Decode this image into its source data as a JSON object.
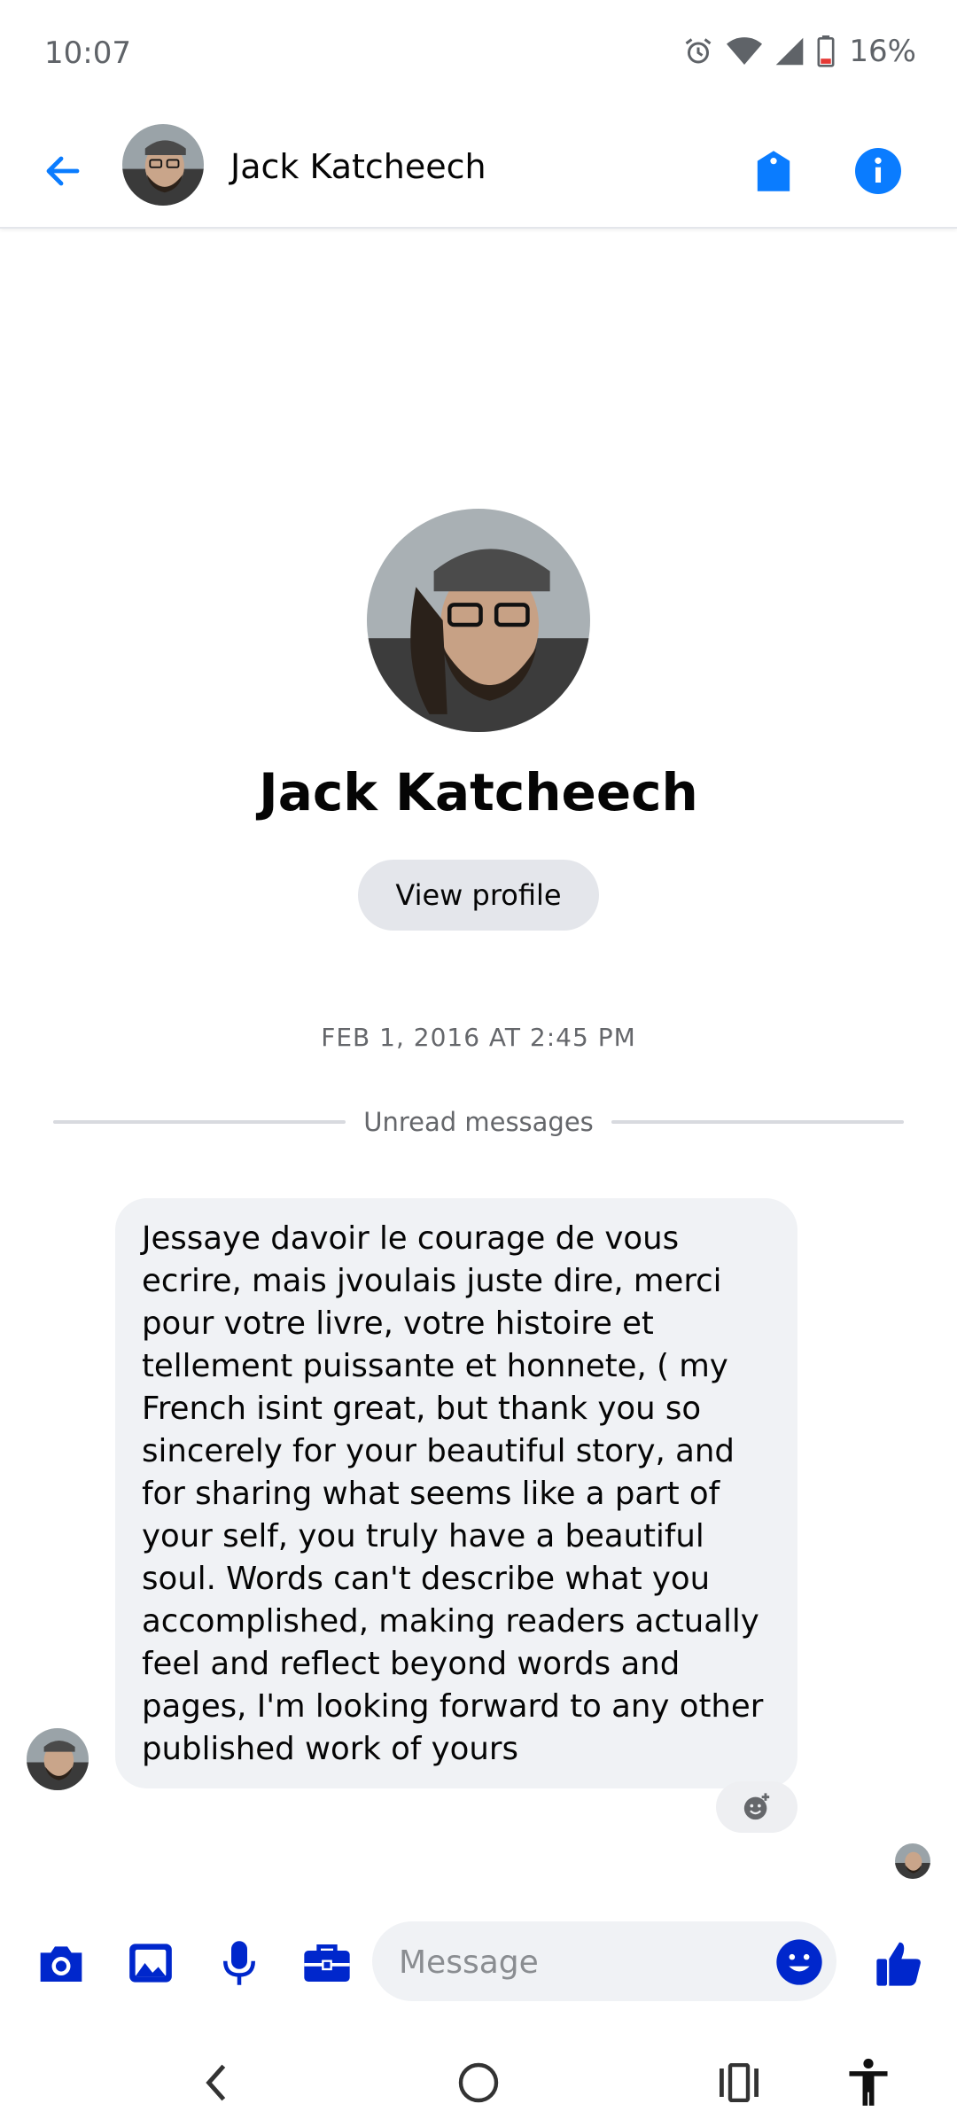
{
  "status_bar": {
    "time": "10:07",
    "battery": "16%",
    "icons": [
      "alarm-icon",
      "wifi-icon",
      "signal-icon",
      "battery-low-icon"
    ]
  },
  "header": {
    "back_icon": "arrow-left-icon",
    "contact_name": "Jack Katcheech",
    "tag_icon": "tag-icon",
    "info_icon": "info-icon"
  },
  "profile": {
    "name": "Jack Katcheech",
    "view_profile_label": "View profile"
  },
  "conversation": {
    "timestamp": "FEB 1, 2016 AT 2:45 PM",
    "unread_label": "Unread messages",
    "messages": [
      {
        "sender": "Jack Katcheech",
        "text": "Jessaye davoir le courage de vous ecrire, mais jvoulais juste dire, merci pour votre livre, votre histoire et tellement puissante et honnete, ( my French isint great, but thank you so sincerely for your beautiful story, and for sharing what seems like a part of your self, you truly have a beautiful soul. Words can't describe what you accomplished, making readers actually feel and reflect beyond words and pages, I'm looking forward to any other published work of yours"
      }
    ]
  },
  "composer": {
    "placeholder": "Message",
    "icons": [
      "camera-icon",
      "image-icon",
      "microphone-icon",
      "briefcase-icon",
      "emoji-icon",
      "thumbs-up-icon"
    ]
  },
  "colors": {
    "accent": "#0a7cff",
    "composer_icon": "#0027cc",
    "bubble": "#f0f2f5",
    "pill": "#e4e6eb"
  }
}
